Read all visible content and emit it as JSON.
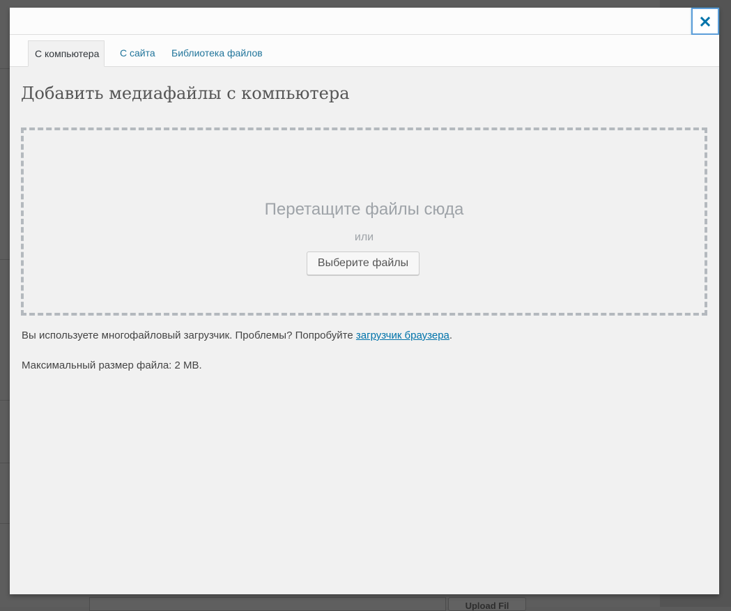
{
  "background": {
    "bottom_button_label": "Upload Fil"
  },
  "modal": {
    "close_label": "×",
    "tabs": [
      {
        "label": "С компьютера",
        "active": true
      },
      {
        "label": "С сайта",
        "active": false
      },
      {
        "label": "Библиотека файлов",
        "active": false
      }
    ],
    "heading": "Добавить медиафайлы с компьютера",
    "drop_area": {
      "instructions": "Перетащите файлы сюда",
      "or": "или",
      "select_button": "Выберите файлы"
    },
    "notice": {
      "text_before": "Вы используете многофайловый загрузчик. Проблемы? Попробуйте ",
      "link": "загрузчик браузера",
      "text_after": "."
    },
    "max_size": "Максимальный размер файла: 2 MB."
  },
  "colors": {
    "accent": "#0073aa",
    "close_icon": "#0073aa",
    "overlay": "#5d5d5d"
  },
  "icons": {
    "close": "close-icon"
  }
}
